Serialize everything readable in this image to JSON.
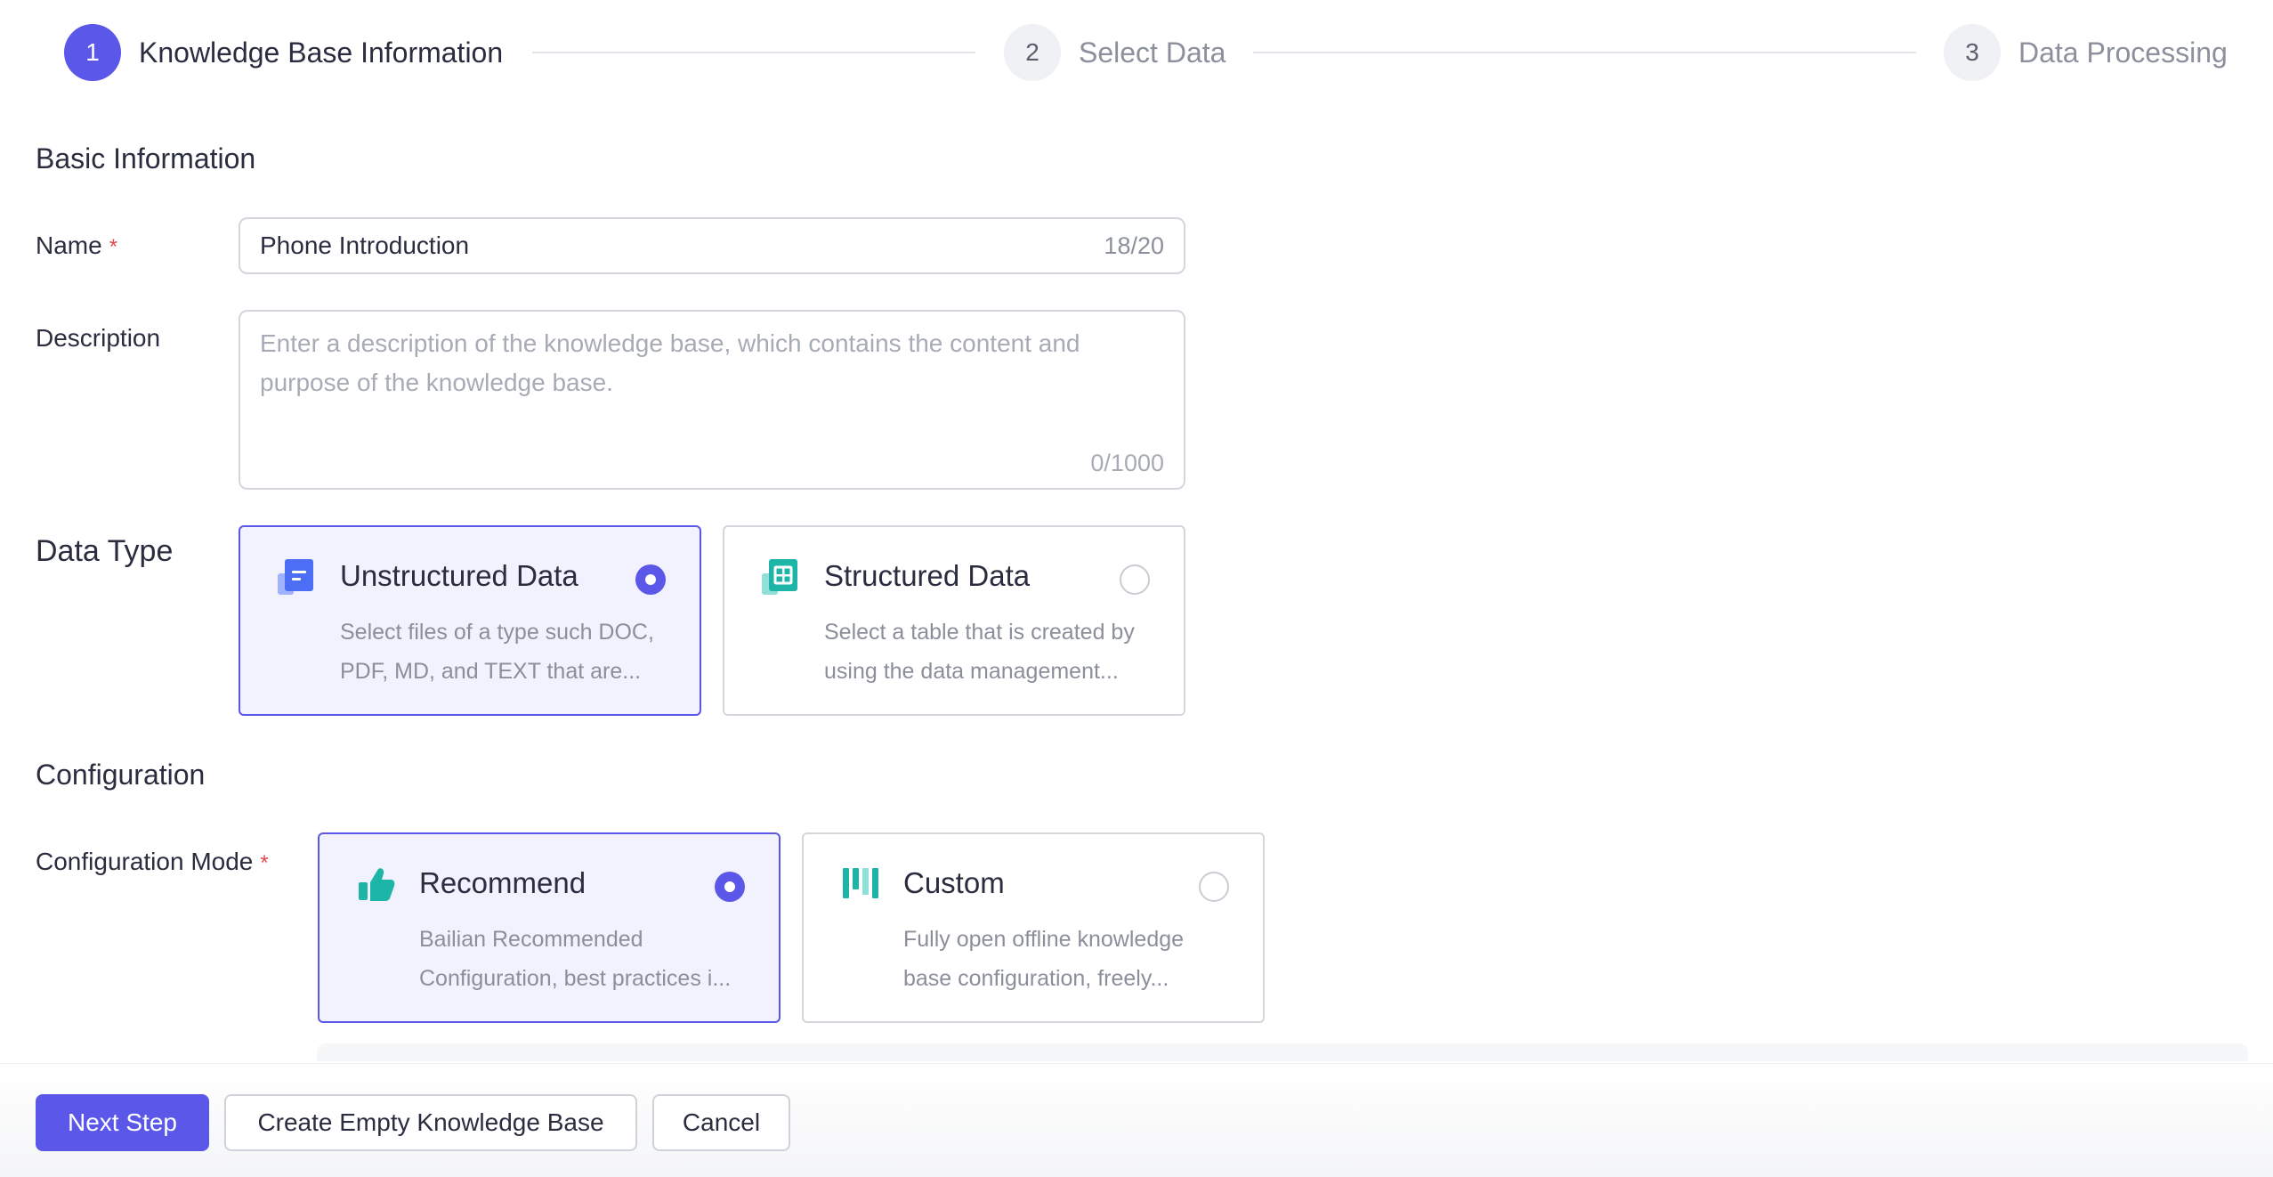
{
  "steps": [
    {
      "number": "1",
      "label": "Knowledge Base Information",
      "state": "active"
    },
    {
      "number": "2",
      "label": "Select Data",
      "state": "inactive"
    },
    {
      "number": "3",
      "label": "Data Processing",
      "state": "inactive"
    }
  ],
  "basic_info": {
    "title": "Basic Information",
    "name": {
      "label": "Name",
      "required_mark": "*",
      "value": "Phone Introduction",
      "count": "18/20"
    },
    "description": {
      "label": "Description",
      "placeholder_line1": "Enter a description of the knowledge base, which contains the content and",
      "placeholder_line2": "purpose of the knowledge base.",
      "count": "0/1000"
    }
  },
  "data_type": {
    "label": "Data Type",
    "options": [
      {
        "title": "Unstructured Data",
        "desc_line1": "Select files of a type such DOC,",
        "desc_line2": "PDF, MD, and TEXT that are...",
        "icon": "document-icon",
        "selected": true
      },
      {
        "title": "Structured Data",
        "desc_line1": "Select a table that is created by",
        "desc_line2": "using the data management...",
        "icon": "table-icon",
        "selected": false
      }
    ]
  },
  "configuration": {
    "title": "Configuration",
    "mode_label": "Configuration Mode",
    "required_mark": "*",
    "options": [
      {
        "title": "Recommend",
        "desc_line1": "Bailian Recommended",
        "desc_line2": "Configuration, best practices i...",
        "icon": "thumbs-up-icon",
        "selected": true
      },
      {
        "title": "Custom",
        "desc_line1": "Fully open offline knowledge",
        "desc_line2": "base configuration, freely...",
        "icon": "bars-icon",
        "selected": false
      }
    ]
  },
  "footer": {
    "next_label": "Next Step",
    "create_empty_label": "Create Empty Knowledge Base",
    "cancel_label": "Cancel"
  },
  "colors": {
    "primary": "#5b57e8",
    "selected_card_bg": "#f2f1fe",
    "required": "#e0494a",
    "icon_blue": "#4b6ef5",
    "icon_teal": "#1cb5a8"
  }
}
